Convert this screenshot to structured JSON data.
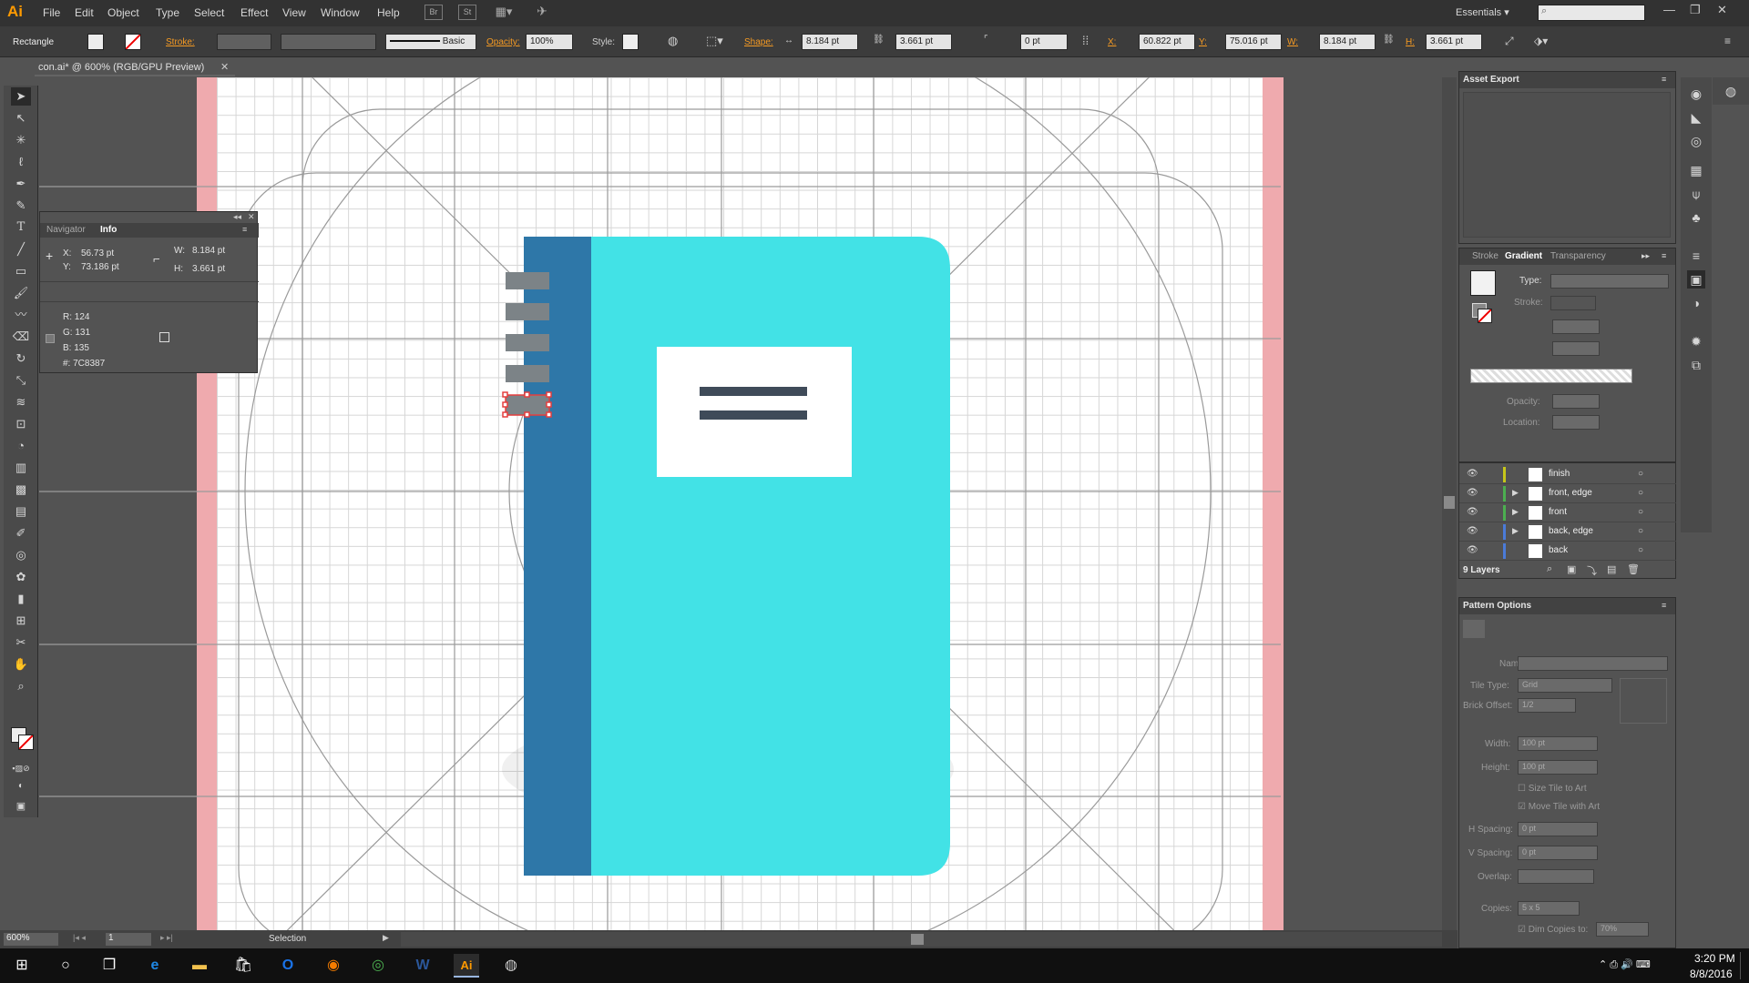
{
  "app": {
    "logo": "Ai",
    "menu": [
      "File",
      "Edit",
      "Object",
      "Type",
      "Select",
      "Effect",
      "View",
      "Window",
      "Help"
    ],
    "workspace": "Essentials"
  },
  "control_bar": {
    "tool_name": "Rectangle",
    "stroke_label": "Stroke:",
    "brush": "Basic",
    "opacity_label": "Opacity:",
    "opacity_value": "100%",
    "style_label": "Style:",
    "shape_label": "Shape:",
    "shape_w": "8.184 pt",
    "shape_h": "3.661 pt",
    "corner_value": "0 pt",
    "x_label": "X:",
    "x_value": "60.822 pt",
    "y_label": "Y:",
    "y_value": "75.016 pt",
    "w_label": "W:",
    "w_value": "8.184 pt",
    "h_label": "H:",
    "h_value": "3.661 pt"
  },
  "document": {
    "tab_title": "con.ai* @ 600% (RGB/GPU Preview)"
  },
  "info_panel": {
    "tabs": [
      "Navigator",
      "Info"
    ],
    "x": "X:",
    "x_val": "56.73 pt",
    "y": "Y:",
    "y_val": "73.186 pt",
    "w": "W:",
    "w_val": "8.184 pt",
    "h": "H:",
    "h_val": "3.661 pt",
    "r": "R: 124",
    "g": "G: 131",
    "b": "B: 135",
    "hex": "#: 7C8387"
  },
  "asset_export": {
    "title": "Asset Export"
  },
  "gradient_panel": {
    "tabs": [
      "Stroke",
      "Gradient",
      "Transparency"
    ],
    "type_label": "Type:",
    "stroke_label": "Stroke:",
    "opacity_label": "Opacity:",
    "location_label": "Location:"
  },
  "layers": {
    "rows": [
      "finish",
      "front, edge",
      "front",
      "back, edge",
      "back"
    ],
    "row_colors": [
      "#c6c61a",
      "#4caf50",
      "#4caf50",
      "#4b7bd8",
      "#4b7bd8"
    ],
    "count": "9 Layers"
  },
  "pattern_options": {
    "title": "Pattern Options",
    "name_label": "Name:",
    "tile_type_label": "Tile Type:",
    "tile_type_value": "Grid",
    "brick_offset_label": "Brick Offset:",
    "brick_offset_value": "1/2",
    "width_label": "Width:",
    "width_value": "100 pt",
    "height_label": "Height:",
    "height_value": "100 pt",
    "size_tile": "Size Tile to Art",
    "move_tile": "Move Tile with Art",
    "h_spacing_label": "H Spacing:",
    "h_spacing_value": "0 pt",
    "v_spacing_label": "V Spacing:",
    "v_spacing_value": "0 pt",
    "overlap_label": "Overlap:",
    "copies_label": "Copies:",
    "copies_value": "5 x 5",
    "dim_copies": "Dim Copies to:",
    "dim_value": "70%"
  },
  "status_bar": {
    "zoom": "600%",
    "page": "1",
    "tool": "Selection"
  },
  "taskbar": {
    "time": "3:20 PM",
    "date": "8/8/2016"
  },
  "colors": {
    "notebook_cover": "#42e2e6",
    "notebook_spine": "#2e77a8",
    "spiral": "#7c8387",
    "label_lines": "#3f4b59",
    "selection": "#e53e3e"
  }
}
